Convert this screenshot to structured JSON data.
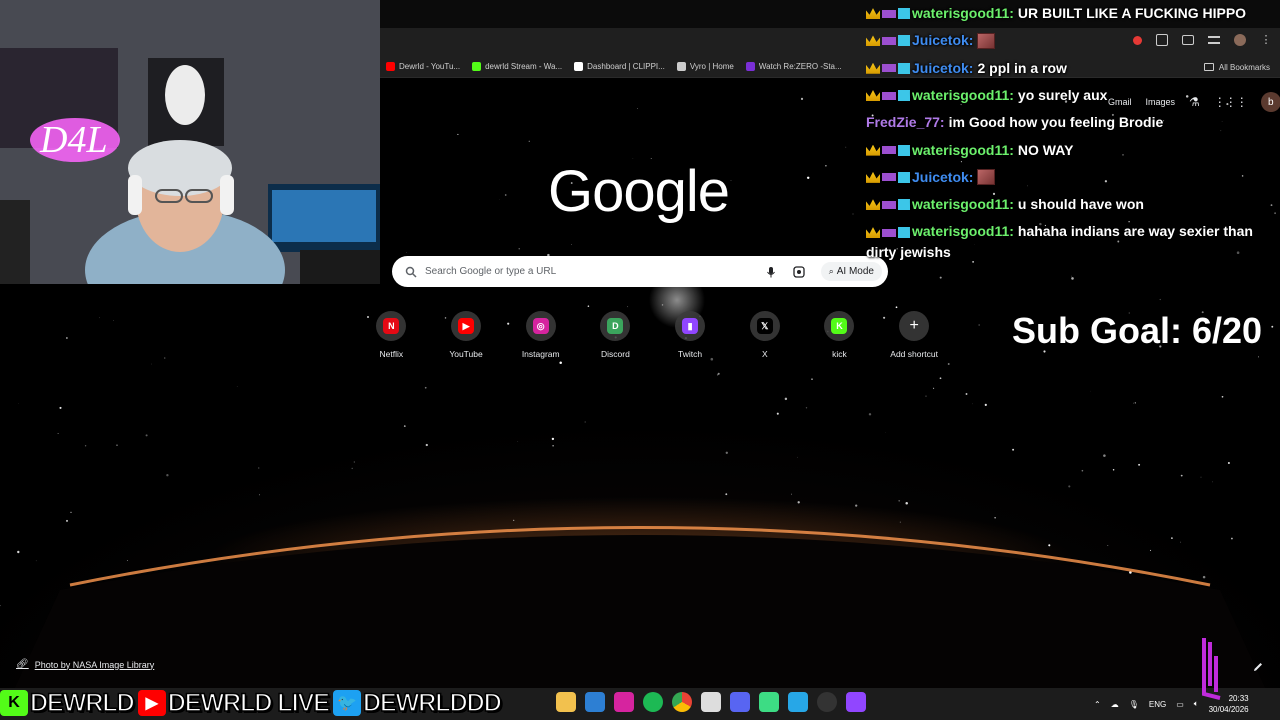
{
  "browser": {
    "bookmarks": [
      {
        "label": "Dewrld - YouTu...",
        "color": "#ff0000"
      },
      {
        "label": "dewrld Stream - Wa...",
        "color": "#53fc18"
      },
      {
        "label": "Dashboard | CLIPPI...",
        "color": "#ffffff"
      },
      {
        "label": "Vyro | Home",
        "color": "#cccccc"
      },
      {
        "label": "Watch Re:ZERO -Sta...",
        "color": "#7a2fd6"
      }
    ],
    "all_bookmarks_label": "All Bookmarks"
  },
  "google": {
    "links": {
      "gmail": "Gmail",
      "images": "Images"
    },
    "avatar_letter": "b",
    "logo": "Google",
    "search_placeholder": "Search Google or type a URL",
    "ai_mode": "AI Mode",
    "shortcuts": [
      {
        "label": "Netflix",
        "glyph": "N",
        "color": "#e50914"
      },
      {
        "label": "YouTube",
        "glyph": "▶",
        "color": "#ff0000"
      },
      {
        "label": "Instagram",
        "glyph": "◎",
        "color": "#d6249f"
      },
      {
        "label": "Discord",
        "glyph": "D",
        "color": "#3ba55d"
      },
      {
        "label": "Twitch",
        "glyph": "▮",
        "color": "#9146ff"
      },
      {
        "label": "X",
        "glyph": "𝕏",
        "color": "#000000"
      },
      {
        "label": "kick",
        "glyph": "K",
        "color": "#53fc18"
      },
      {
        "label": "Add shortcut",
        "glyph": "+",
        "color": "transparent"
      }
    ],
    "photo_credit": "Photo by NASA Image Library"
  },
  "chat": [
    {
      "user": "waterisgood11",
      "user_color": "#6cf06c",
      "text": "UR BUILT LIKE A FUCKING HIPPO",
      "badges": true,
      "emote": false
    },
    {
      "user": "Juicetok",
      "user_color": "#3f8cf0",
      "text": "",
      "badges": true,
      "emote": true
    },
    {
      "user": "Juicetok",
      "user_color": "#3f8cf0",
      "text": "2 ppl in a row",
      "badges": true,
      "emote": false
    },
    {
      "user": "waterisgood11",
      "user_color": "#6cf06c",
      "text": "yo surely aux",
      "badges": true,
      "emote": false
    },
    {
      "user": "FredZie_77",
      "user_color": "#b07ae8",
      "text": "im Good how you feeling Brodie",
      "badges": false,
      "emote": false
    },
    {
      "user": "waterisgood11",
      "user_color": "#6cf06c",
      "text": "NO WAY",
      "badges": true,
      "emote": false
    },
    {
      "user": "Juicetok",
      "user_color": "#3f8cf0",
      "text": "",
      "badges": true,
      "emote": true
    },
    {
      "user": "waterisgood11",
      "user_color": "#6cf06c",
      "text": "u should have won",
      "badges": true,
      "emote": false
    },
    {
      "user": "waterisgood11",
      "user_color": "#6cf06c",
      "text": "hahaha indians are way sexier than dirty jewishs",
      "badges": true,
      "emote": false
    }
  ],
  "sub_goal": "Sub Goal: 6/20",
  "socials": [
    {
      "platform": "kick",
      "handle": "DEWRLD",
      "color": "#53fc18",
      "glyph": "K"
    },
    {
      "platform": "youtube",
      "handle": "DEWRLD LIVE",
      "color": "#ff0000",
      "glyph": "▶"
    },
    {
      "platform": "twitter",
      "handle": "DEWRLDDD",
      "color": "#1da1f2",
      "glyph": "🐦"
    }
  ],
  "taskbar": {
    "language": "ENG",
    "time": "20:33",
    "date": "30/04/2026"
  }
}
